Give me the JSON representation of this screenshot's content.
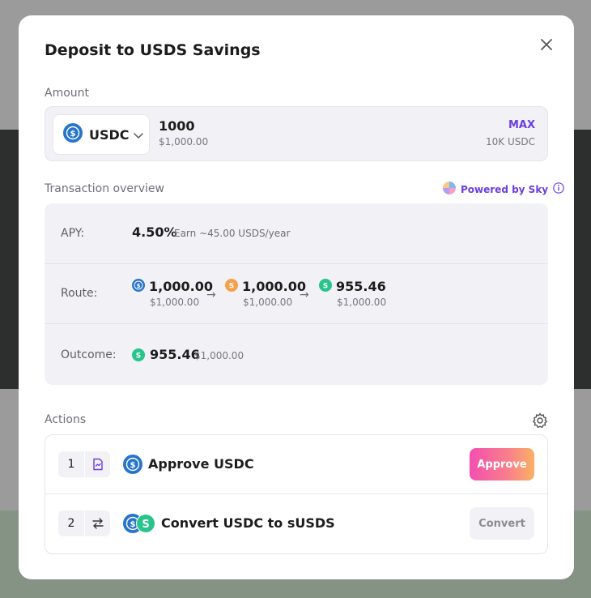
{
  "modal": {
    "title": "Deposit to USDS Savings",
    "amount_label": "Amount",
    "token_symbol": "USDC",
    "amount_value": "1000",
    "amount_usd": "$1,000.00",
    "max_label": "MAX",
    "balance": "10K USDC",
    "overview_label": "Transaction overview",
    "powered_by": "Powered by Sky",
    "overview": {
      "apy_label": "APY:",
      "apy_value": "4.50%",
      "apy_earn": "Earn ~45.00 USDS/year",
      "route_label": "Route:",
      "route": [
        {
          "amount": "1,000.00",
          "usd": "$1,000.00",
          "token": "usdc"
        },
        {
          "amount": "1,000.00",
          "usd": "$1,000.00",
          "token": "usds"
        },
        {
          "amount": "955.46",
          "usd": "$1,000.00",
          "token": "susds"
        }
      ],
      "outcome_label": "Outcome:",
      "outcome_amount": "955.46",
      "outcome_usd": "$1,000.00"
    },
    "actions_label": "Actions",
    "actions": [
      {
        "step": "1",
        "title": "Approve USDC",
        "button": "Approve"
      },
      {
        "step": "2",
        "title": "Convert USDC to sUSDS",
        "button": "Convert"
      }
    ]
  },
  "colors": {
    "accent": "#6a3ee0",
    "usdc": "#2775ca",
    "usds": "#f5a04a",
    "susds": "#27c48b"
  },
  "icons": [
    "close-icon",
    "chevron-down-icon",
    "sky-logo-icon",
    "info-icon",
    "gear-icon",
    "file-sign-icon",
    "swap-arrows-icon"
  ]
}
